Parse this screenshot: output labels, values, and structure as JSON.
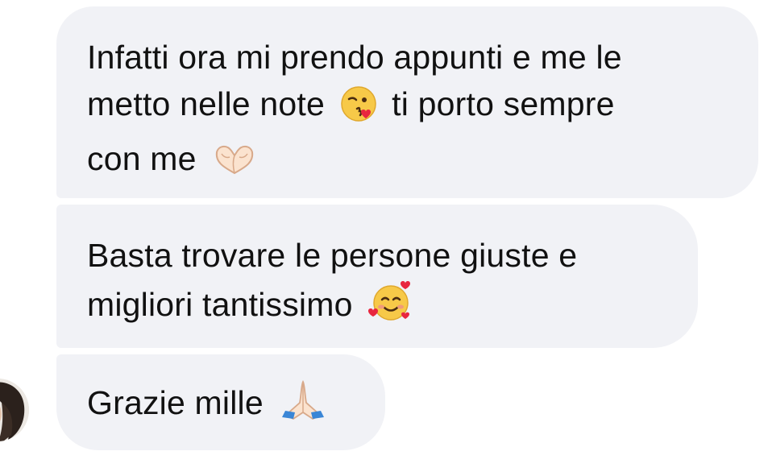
{
  "messages": [
    {
      "segments": [
        {
          "type": "text",
          "value": "Infatti ora mi prendo appunti e me le"
        },
        {
          "type": "br"
        },
        {
          "type": "text",
          "value": "metto nelle note "
        },
        {
          "type": "emoji",
          "name": "face-blowing-kiss-icon"
        },
        {
          "type": "text",
          "value": " ti porto sempre"
        },
        {
          "type": "br"
        },
        {
          "type": "text",
          "value": "con me "
        },
        {
          "type": "emoji",
          "name": "heart-hands-icon"
        }
      ]
    },
    {
      "segments": [
        {
          "type": "text",
          "value": "Basta trovare le persone giuste e"
        },
        {
          "type": "br"
        },
        {
          "type": "text",
          "value": "migliori tantissimo "
        },
        {
          "type": "emoji",
          "name": "smiling-face-with-hearts-icon"
        }
      ]
    },
    {
      "segments": [
        {
          "type": "text",
          "value": "Grazie mille "
        },
        {
          "type": "emoji",
          "name": "folded-hands-icon"
        }
      ]
    }
  ],
  "colors": {
    "bubble": "#f1f2f6",
    "text": "#111111",
    "background": "#ffffff"
  }
}
